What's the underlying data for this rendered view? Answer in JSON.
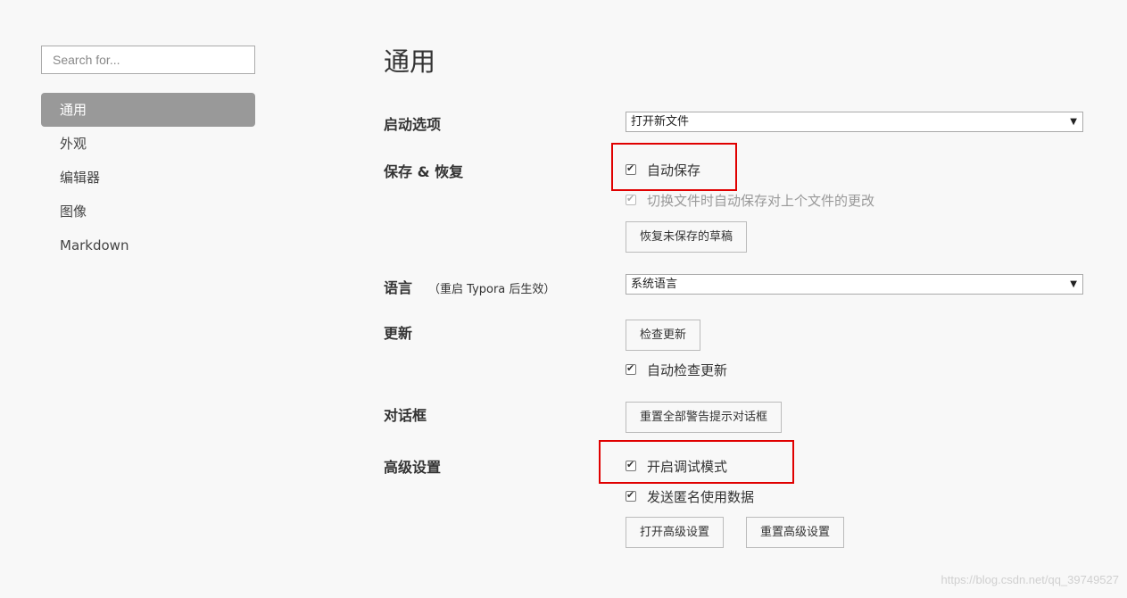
{
  "sidebar": {
    "search_placeholder": "Search for...",
    "items": [
      {
        "label": "通用"
      },
      {
        "label": "外观"
      },
      {
        "label": "编辑器"
      },
      {
        "label": "图像"
      },
      {
        "label": "Markdown"
      }
    ]
  },
  "main": {
    "title": "通用",
    "startup": {
      "label": "启动选项",
      "select_value": "打开新文件"
    },
    "save_restore": {
      "label": "保存 & 恢复",
      "auto_save": {
        "label": "自动保存",
        "checked": true
      },
      "save_on_switch": {
        "label": "切换文件时自动保存对上个文件的更改",
        "checked": true,
        "disabled": true
      },
      "restore_button": "恢复未保存的草稿"
    },
    "language": {
      "label": "语言",
      "note": "（重启 Typora 后生效）",
      "select_value": "系统语言"
    },
    "update": {
      "label": "更新",
      "check_button": "检查更新",
      "auto_check": {
        "label": "自动检查更新",
        "checked": true
      }
    },
    "dialog": {
      "label": "对话框",
      "reset_button": "重置全部警告提示对话框"
    },
    "advanced": {
      "label": "高级设置",
      "debug_mode": {
        "label": "开启调试模式",
        "checked": true
      },
      "send_anonymous": {
        "label": "发送匿名使用数据",
        "checked": true
      },
      "open_button": "打开高级设置",
      "reset_button": "重置高级设置"
    }
  },
  "watermark": "https://blog.csdn.net/qq_39749527",
  "colors": {
    "highlight": "#e00000",
    "active_nav": "#999999",
    "background": "#f8f8f8"
  }
}
